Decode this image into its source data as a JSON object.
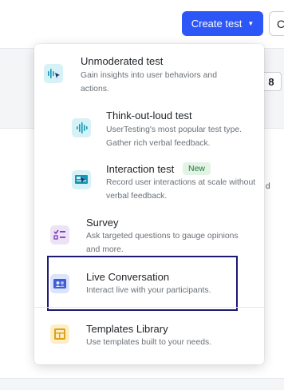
{
  "header": {
    "create_button_label": "Create test",
    "edge_button_label": "C"
  },
  "background": {
    "badge_value": "8",
    "side_mark": "d"
  },
  "menu": {
    "unmoderated": {
      "title": "Unmoderated test",
      "description": "Gain insights into user behaviors and actions.",
      "icon": "cursor-waveform-icon"
    },
    "think_out_loud": {
      "title": "Think-out-loud test",
      "description": "UserTesting's most popular test type. Gather rich verbal feedback.",
      "icon": "waveform-icon"
    },
    "interaction": {
      "title": "Interaction test",
      "badge": "New",
      "description": "Record user interactions at scale without verbal feedback.",
      "icon": "cursor-screen-icon"
    },
    "survey": {
      "title": "Survey",
      "description": "Ask targeted questions to gauge opinions and more.",
      "icon": "checklist-icon"
    },
    "live_conversation": {
      "title": "Live Conversation",
      "description": "Interact live with your participants.",
      "icon": "people-video-icon"
    },
    "templates": {
      "title": "Templates Library",
      "description": "Use templates built to your needs.",
      "icon": "template-layout-icon"
    }
  },
  "colors": {
    "primary": "#2c56f5",
    "highlight_border": "#1d1a72",
    "teal_icon_bg": "#d6f2f7",
    "purple_icon_bg": "#ede3f7",
    "blue_icon_bg": "#dce4fb",
    "yellow_icon_bg": "#fdeec4"
  }
}
